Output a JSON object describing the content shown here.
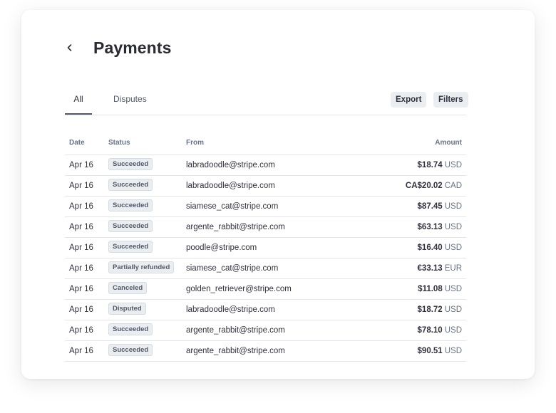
{
  "page": {
    "title": "Payments"
  },
  "tabs": [
    {
      "label": "All",
      "active": true
    },
    {
      "label": "Disputes",
      "active": false
    }
  ],
  "actions": {
    "export_label": "Export",
    "filters_label": "Filters"
  },
  "table": {
    "columns": [
      "Date",
      "Status",
      "From",
      "Amount"
    ],
    "rows": [
      {
        "date": "Apr 16",
        "status": "Succeeded",
        "from": "labradoodle@stripe.com",
        "amount": "$18.74",
        "currency": "USD"
      },
      {
        "date": "Apr 16",
        "status": "Succeeded",
        "from": "labradoodle@stripe.com",
        "amount": "CA$20.02",
        "currency": "CAD"
      },
      {
        "date": "Apr 16",
        "status": "Succeeded",
        "from": "siamese_cat@stripe.com",
        "amount": "$87.45",
        "currency": "USD"
      },
      {
        "date": "Apr 16",
        "status": "Succeeded",
        "from": "argente_rabbit@stripe.com",
        "amount": "$63.13",
        "currency": "USD"
      },
      {
        "date": "Apr 16",
        "status": "Succeeded",
        "from": "poodle@stripe.com",
        "amount": "$16.40",
        "currency": "USD"
      },
      {
        "date": "Apr 16",
        "status": "Partially refunded",
        "from": "siamese_cat@stripe.com",
        "amount": "€33.13",
        "currency": "EUR"
      },
      {
        "date": "Apr 16",
        "status": "Canceled",
        "from": "golden_retriever@stripe.com",
        "amount": "$11.08",
        "currency": "USD"
      },
      {
        "date": "Apr 16",
        "status": "Disputed",
        "from": "labradoodle@stripe.com",
        "amount": "$18.72",
        "currency": "USD"
      },
      {
        "date": "Apr 16",
        "status": "Succeeded",
        "from": "argente_rabbit@stripe.com",
        "amount": "$78.10",
        "currency": "USD"
      },
      {
        "date": "Apr 16",
        "status": "Succeeded",
        "from": "argente_rabbit@stripe.com",
        "amount": "$90.51",
        "currency": "USD"
      }
    ]
  },
  "icons": {
    "back": "chevron-left-icon"
  },
  "colors": {
    "text_primary": "#30313d",
    "text_secondary": "#687385",
    "badge_bg": "#ebeef1",
    "divider": "#e3e5ea"
  }
}
